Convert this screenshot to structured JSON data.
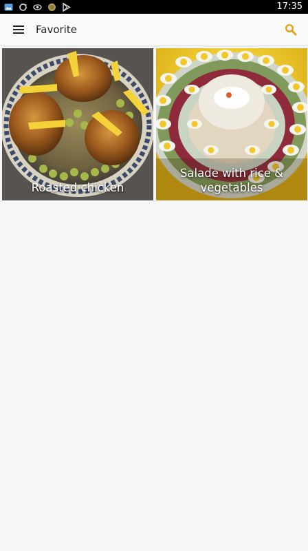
{
  "status_bar": {
    "time": "17:35",
    "icons": [
      "gallery-icon",
      "sync-icon",
      "eye-icon",
      "coin-icon",
      "play-store-icon"
    ]
  },
  "toolbar": {
    "title": "Favorite",
    "menu_icon": "hamburger-menu-icon",
    "search_icon": "search-icon",
    "accent_color": "#e6a117"
  },
  "favorites": [
    {
      "title": "Roasted chicken",
      "image": "roasted-chicken-photo"
    },
    {
      "title": "Salade with rice & vegetables",
      "image": "rice-salad-photo"
    }
  ]
}
